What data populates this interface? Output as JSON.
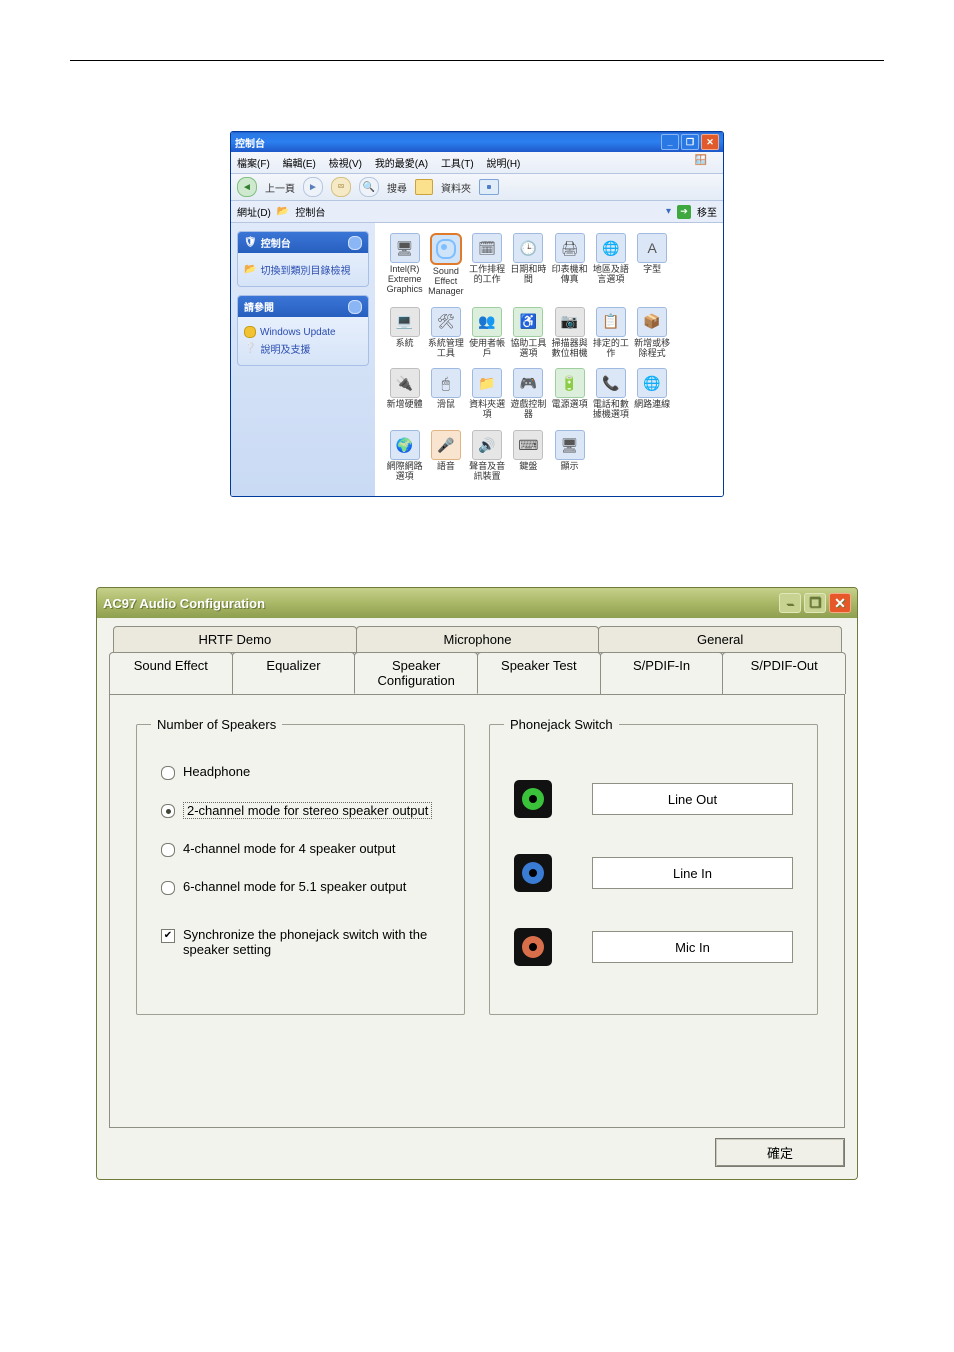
{
  "cp": {
    "title": "控制台",
    "winbtns": {
      "min": "_",
      "max": "❐",
      "close": "✕"
    },
    "menu": [
      "檔案(F)",
      "編輯(E)",
      "檢視(V)",
      "我的最愛(A)",
      "工具(T)",
      "說明(H)"
    ],
    "toolbar": {
      "back": "上一頁",
      "search": "搜尋",
      "folders": "資料夾"
    },
    "addr": {
      "label": "網址(D)",
      "value": "控制台",
      "go": "移至"
    },
    "panel1": {
      "title": "控制台",
      "item": "切換到類別目錄檢視"
    },
    "panel2": {
      "title": "請參閱",
      "items": [
        "Windows Update",
        "說明及支援"
      ]
    },
    "icons": [
      {
        "name": "intel-graphics",
        "label": "Intel(R) Extreme Graphics",
        "cls": "blue",
        "glyph": "🖥"
      },
      {
        "name": "sound-effect-manager",
        "label": "Sound Effect Manager",
        "cls": "blue",
        "glyph": "((●))",
        "selected": true
      },
      {
        "name": "scheduled-tasks",
        "label": "工作排程的工作",
        "cls": "blue",
        "glyph": "🗓"
      },
      {
        "name": "date-time",
        "label": "日期和時間",
        "cls": "blue",
        "glyph": "🕒"
      },
      {
        "name": "printers-fax",
        "label": "印表機和傳真",
        "cls": "blue",
        "glyph": "🖨"
      },
      {
        "name": "region-language",
        "label": "地區及語言選項",
        "cls": "blue",
        "glyph": "🌐"
      },
      {
        "name": "fonts",
        "label": "字型",
        "cls": "blue",
        "glyph": "A"
      },
      {
        "name": "blank",
        "label": "",
        "cls": "gray",
        "glyph": ""
      },
      {
        "name": "system",
        "label": "系統",
        "cls": "gray",
        "glyph": "💻"
      },
      {
        "name": "system-admin",
        "label": "系統管理工具",
        "cls": "blue",
        "glyph": "🛠"
      },
      {
        "name": "user-accounts",
        "label": "使用者帳戶",
        "cls": "grn",
        "glyph": "👥"
      },
      {
        "name": "accessibility",
        "label": "協助工具選項",
        "cls": "grn",
        "glyph": "♿"
      },
      {
        "name": "scanners-cameras",
        "label": "掃描器與數位相機",
        "cls": "gray",
        "glyph": "📷"
      },
      {
        "name": "task",
        "label": "排定的工作",
        "cls": "blue",
        "glyph": "📋"
      },
      {
        "name": "add-remove-programs",
        "label": "新增或移除程式",
        "cls": "blue",
        "glyph": "📦"
      },
      {
        "name": "blank2",
        "label": "",
        "cls": "gray",
        "glyph": ""
      },
      {
        "name": "add-hardware",
        "label": "新增硬體",
        "cls": "gray",
        "glyph": "🔌"
      },
      {
        "name": "mouse",
        "label": "滑鼠",
        "cls": "blue",
        "glyph": "🖱"
      },
      {
        "name": "folder-options",
        "label": "資料夾選項",
        "cls": "blue",
        "glyph": "📁"
      },
      {
        "name": "game-controllers",
        "label": "遊戲控制器",
        "cls": "blue",
        "glyph": "🎮"
      },
      {
        "name": "power-options",
        "label": "電源選項",
        "cls": "grn",
        "glyph": "🔋"
      },
      {
        "name": "phone-modem",
        "label": "電話和數據機選項",
        "cls": "blue",
        "glyph": "📞"
      },
      {
        "name": "network-connections",
        "label": "網路連線",
        "cls": "blue",
        "glyph": "🌐"
      },
      {
        "name": "blank3",
        "label": "",
        "cls": "gray",
        "glyph": ""
      },
      {
        "name": "internet-options",
        "label": "網際網路選項",
        "cls": "blue",
        "glyph": "🌍"
      },
      {
        "name": "speech",
        "label": "語音",
        "cls": "org",
        "glyph": "🎤"
      },
      {
        "name": "sound-audio",
        "label": "聲音及音訊裝置",
        "cls": "gray",
        "glyph": "🔊"
      },
      {
        "name": "keyboard",
        "label": "鍵盤",
        "cls": "gray",
        "glyph": "⌨"
      },
      {
        "name": "display",
        "label": "顯示",
        "cls": "blue",
        "glyph": "🖥"
      }
    ]
  },
  "ac97": {
    "title": "AC97 Audio Configuration",
    "winbtns": {
      "min": "–",
      "max": "❐",
      "close": "✕"
    },
    "tabs_back": [
      "HRTF Demo",
      "Microphone",
      "General"
    ],
    "tabs_front": [
      "Sound Effect",
      "Equalizer",
      "Speaker Configuration",
      "Speaker Test",
      "S/PDIF-In",
      "S/PDIF-Out"
    ],
    "group_speakers": {
      "legend": "Number of Speakers",
      "opts": [
        {
          "id": "headphone",
          "label": "Headphone",
          "checked": false
        },
        {
          "id": "ch2",
          "label": "2-channel mode for stereo speaker output",
          "checked": true,
          "dotted": true
        },
        {
          "id": "ch4",
          "label": "4-channel mode for 4 speaker output",
          "checked": false
        },
        {
          "id": "ch6",
          "label": "6-channel mode for 5.1 speaker output",
          "checked": false
        }
      ],
      "sync": "Synchronize the phonejack switch with the speaker setting"
    },
    "group_jacks": {
      "legend": "Phonejack Switch",
      "jacks": [
        {
          "color": "green",
          "label": "Line Out"
        },
        {
          "color": "blue",
          "label": "Line In"
        },
        {
          "color": "pink",
          "label": "Mic In"
        }
      ]
    },
    "ok": "確定"
  }
}
